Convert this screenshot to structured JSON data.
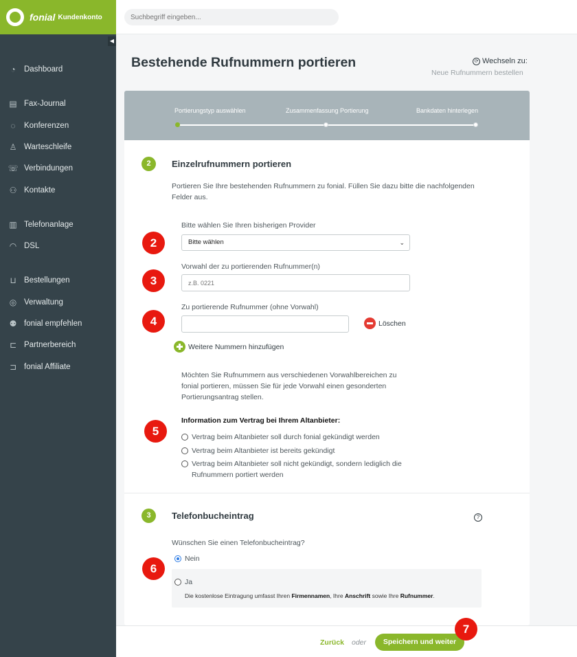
{
  "brand": {
    "name": "fonial",
    "sub": "Kundenkonto"
  },
  "search": {
    "placeholder": "Suchbegriff eingeben..."
  },
  "sidebar": {
    "items": [
      {
        "label": "Dashboard",
        "icon": "dashboard-icon"
      },
      {
        "label": "Fax-Journal",
        "icon": "fax-icon"
      },
      {
        "label": "Konferenzen",
        "icon": "conference-icon"
      },
      {
        "label": "Warteschleife",
        "icon": "queue-icon"
      },
      {
        "label": "Verbindungen",
        "icon": "phone-icon"
      },
      {
        "label": "Kontakte",
        "icon": "contacts-icon"
      },
      {
        "label": "Telefonanlage",
        "icon": "pbx-icon"
      },
      {
        "label": "DSL",
        "icon": "wifi-icon"
      },
      {
        "label": "Bestellungen",
        "icon": "cart-icon"
      },
      {
        "label": "Verwaltung",
        "icon": "user-icon"
      },
      {
        "label": "fonial empfehlen",
        "icon": "recommend-icon"
      },
      {
        "label": "Partnerbereich",
        "icon": "partner-icon"
      },
      {
        "label": "fonial Affiliate",
        "icon": "affiliate-icon"
      }
    ]
  },
  "header": {
    "title": "Bestehende Rufnummern portieren",
    "switch_label": "Wechseln zu:",
    "switch_link": "Neue Rufnummern bestellen"
  },
  "stepper": {
    "steps": [
      "Portierungstyp auswählen",
      "Zusammenfassung Portierung",
      "Bankdaten hinterlegen"
    ]
  },
  "section2": {
    "number": "2",
    "title": "Einzelrufnummern portieren",
    "intro_line1": "Portieren Sie Ihre bestehenden Rufnummern zu fonial. Füllen Sie dazu bitte die nachfolgenden",
    "intro_line2": "Felder aus.",
    "provider_label": "Bitte wählen Sie Ihren bisherigen Provider",
    "provider_value": "Bitte wählen",
    "area_label": "Vorwahl der zu portierenden Rufnummer(n)",
    "area_placeholder": "z.B. 0221",
    "number_label": "Zu portierende Rufnummer (ohne Vorwahl)",
    "number_value": "",
    "delete_label": "Löschen",
    "add_label": "Weitere Nummern hinzufügen",
    "hint_line1": "Möchten Sie Rufnummern aus verschiedenen Vorwahlbereichen zu",
    "hint_line2": "fonial portieren, müssen Sie für jede Vorwahl einen gesonderten",
    "hint_line3": "Portierungsantrag stellen.",
    "contract_label": "Information zum Vertrag bei Ihrem Altanbieter:",
    "options": [
      "Vertrag beim Altanbieter soll durch fonial gekündigt werden",
      "Vertrag beim Altanbieter ist bereits gekündigt",
      "Vertrag beim Altanbieter soll nicht gekündigt, sondern lediglich die",
      "Rufnummern portiert werden"
    ]
  },
  "section3": {
    "number": "3",
    "title": "Telefonbucheintrag",
    "question": "Wünschen Sie einen Telefonbucheintrag?",
    "option_no": "Nein",
    "option_yes": "Ja",
    "note_prefix": "Die kostenlose Eintragung umfasst Ihren ",
    "note_b1": "Firmennamen",
    "note_mid1": ", Ihre ",
    "note_b2": "Anschrift",
    "note_mid2": " sowie Ihre ",
    "note_b3": "Rufnummer",
    "note_suffix": "."
  },
  "markers": [
    "2",
    "3",
    "4",
    "5",
    "6",
    "7"
  ],
  "footer": {
    "back": "Zurück",
    "or": "oder",
    "save": "Speichern und weiter"
  },
  "colors": {
    "brand_green": "#8ab72b",
    "sidebar": "#35434a",
    "stepper": "#a8b4b9",
    "marker_red": "#e8190f"
  }
}
